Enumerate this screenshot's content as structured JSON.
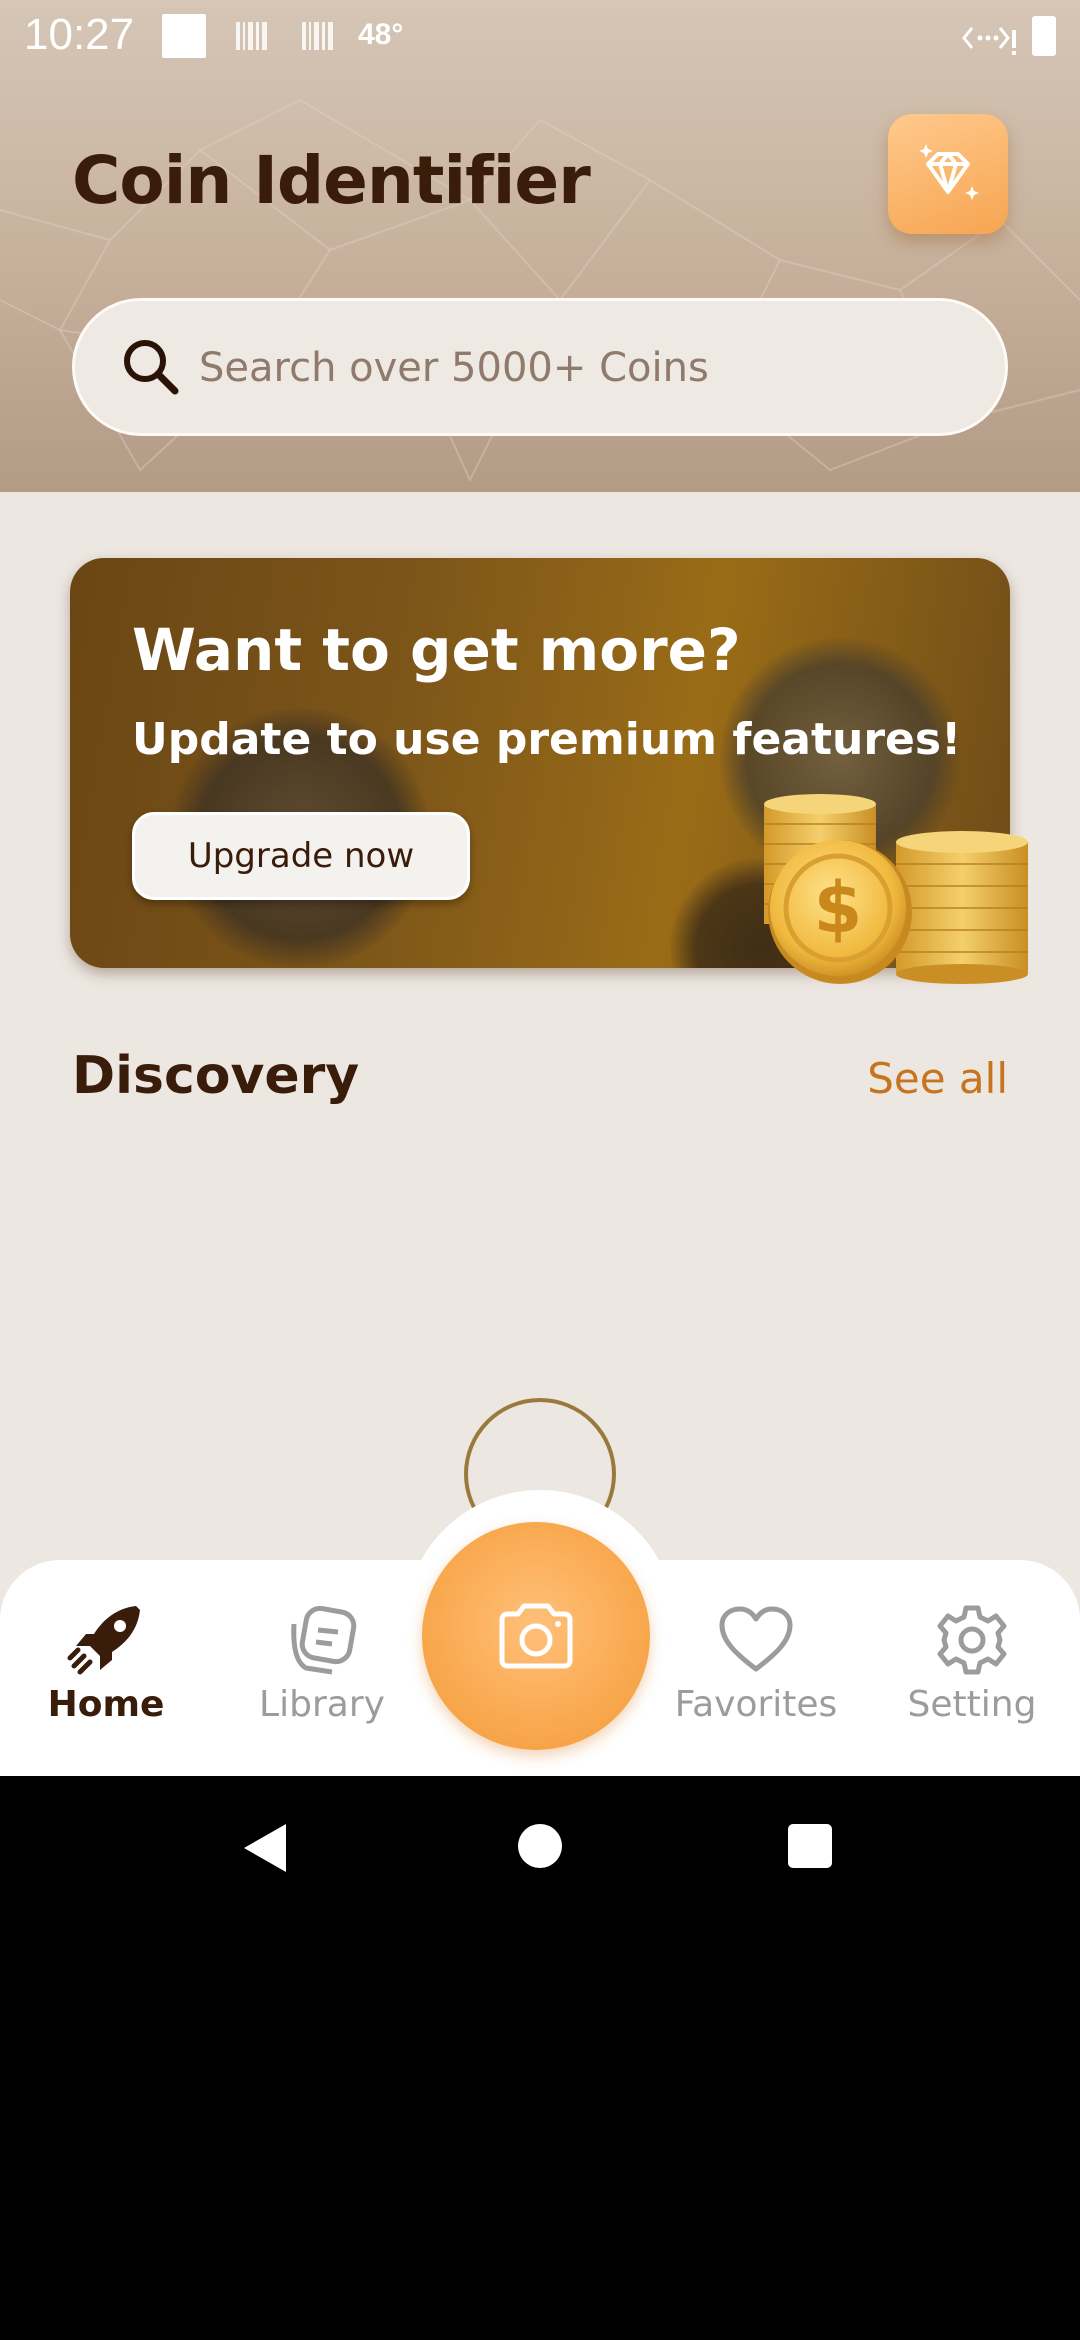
{
  "status_bar": {
    "time": "10:27",
    "temperature": "48°"
  },
  "header": {
    "title": "Coin Identifier",
    "premium_icon": "diamond-icon"
  },
  "search": {
    "placeholder": "Search over 5000+ Coins",
    "icon": "search-icon"
  },
  "banner": {
    "heading": "Want to get more?",
    "subheading": "Update to use premium features!",
    "button_label": "Upgrade now"
  },
  "discovery": {
    "title": "Discovery",
    "see_all_label": "See all"
  },
  "bottom_nav": {
    "items": [
      {
        "label": "Home",
        "icon": "rocket-icon",
        "active": true
      },
      {
        "label": "Library",
        "icon": "library-icon",
        "active": false
      },
      {
        "label": "Favorites",
        "icon": "heart-icon",
        "active": false
      },
      {
        "label": "Setting",
        "icon": "gear-icon",
        "active": false
      }
    ],
    "camera_icon": "camera-icon"
  },
  "colors": {
    "accent": "#f9a94f",
    "title": "#3a1c0b",
    "link": "#c7741e",
    "background": "#ede7e2"
  }
}
